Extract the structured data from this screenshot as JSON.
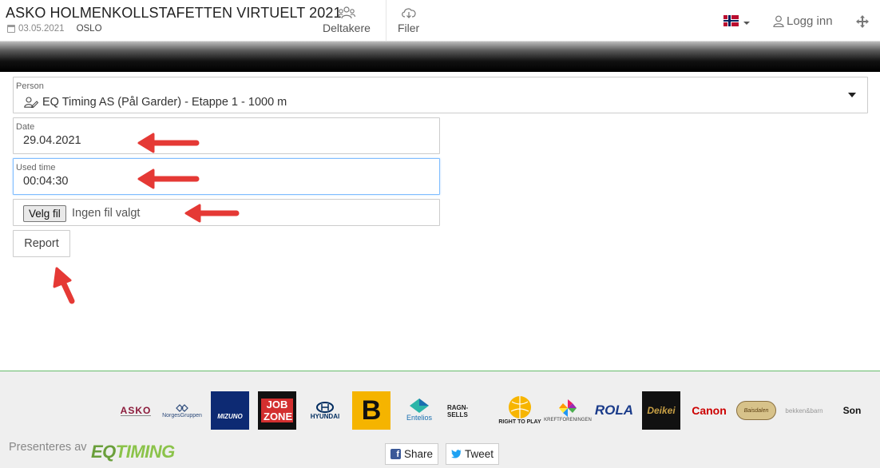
{
  "header": {
    "event_title": "ASKO HOLMENKOLLSTAFETTEN VIRTUELT 2021",
    "date": "03.05.2021",
    "city": "OSLO",
    "tabs": [
      {
        "label": "Deltakere",
        "icon": "people-icon"
      },
      {
        "label": "Filer",
        "icon": "cloud-download-icon"
      }
    ],
    "language_flag": "norway-flag-icon",
    "login_label": "Logg inn"
  },
  "form": {
    "person": {
      "label": "Person",
      "value": "EQ Timing AS (Pål Garder) - Etappe 1 - 1000 m"
    },
    "date": {
      "label": "Date",
      "value": "29.04.2021"
    },
    "used_time": {
      "label": "Used time",
      "value": "00:04:30"
    },
    "file": {
      "button_label": "Velg fil",
      "status": "Ingen fil valgt"
    },
    "report_label": "Report"
  },
  "sponsors": [
    {
      "name": "ASKO"
    },
    {
      "name": "NorgesGruppen"
    },
    {
      "name": "MIZUNO"
    },
    {
      "name": "JOB ZONE"
    },
    {
      "name": "HYUNDAI"
    },
    {
      "name": "B"
    },
    {
      "name": "Entelios"
    },
    {
      "name": "RAGN-SELLS"
    },
    {
      "name": "RIGHT TO PLAY"
    },
    {
      "name": "KREFTFORENINGEN"
    },
    {
      "name": "ROLA"
    },
    {
      "name": "Deikei"
    },
    {
      "name": "Canon"
    },
    {
      "name": "Baisdalen"
    },
    {
      "name": "bekken&barn"
    },
    {
      "name": "Son"
    }
  ],
  "footer": {
    "presented_by": "Presenteres av",
    "brand_eq": "EQ",
    "brand_timing": "TIMING",
    "share_label": "Share",
    "tweet_label": "Tweet"
  },
  "colors": {
    "annotation_arrow": "#e53935",
    "accent_green": "#8bc34a",
    "focus_border": "#80bdff"
  }
}
